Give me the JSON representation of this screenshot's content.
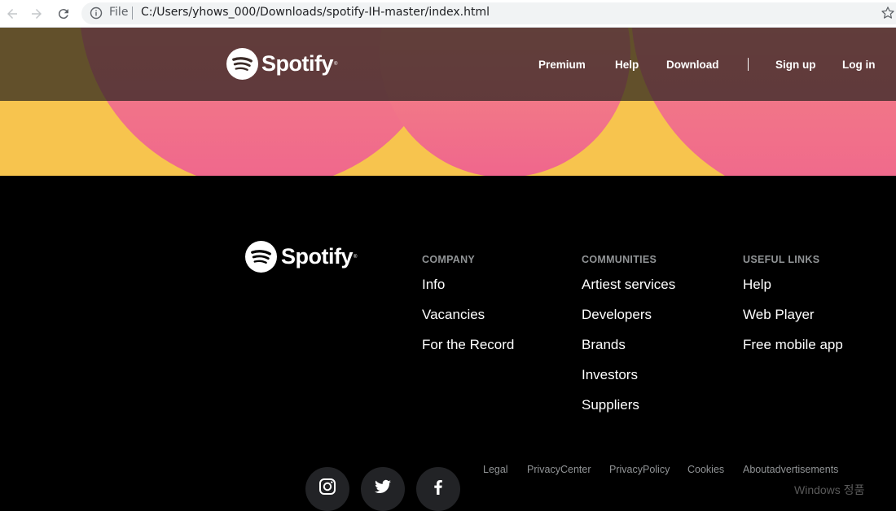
{
  "browser": {
    "scheme": "File",
    "url": "C:/Users/yhows_000/Downloads/spotify-IH-master/index.html"
  },
  "header": {
    "logo_text": "Spotify",
    "nav": [
      {
        "label": "Premium"
      },
      {
        "label": "Help"
      },
      {
        "label": "Download"
      },
      {
        "label": "Sign up"
      },
      {
        "label": "Log in"
      }
    ]
  },
  "footer": {
    "logo_text": "Spotify",
    "columns": [
      {
        "heading": "COMPANY",
        "links": [
          "Info",
          "Vacancies",
          "For the Record"
        ]
      },
      {
        "heading": "COMMUNITIES",
        "links": [
          "Artiest services",
          "Developers",
          "Brands",
          "Investors",
          "Suppliers"
        ]
      },
      {
        "heading": "USEFUL LINKS",
        "links": [
          "Help",
          "Web Player",
          "Free mobile app"
        ]
      }
    ],
    "social": [
      "instagram-icon",
      "twitter-icon",
      "facebook-icon"
    ],
    "legal": [
      "Legal",
      "PrivacyCenter",
      "PrivacyPolicy",
      "Cookies",
      "Aboutadvertisements"
    ],
    "watermark": "Windows 정품"
  },
  "colors": {
    "hero_yellow": "#f7c44e",
    "hero_pink": "#f0748a",
    "footer_bg": "#000000",
    "footer_heading": "#919496"
  }
}
